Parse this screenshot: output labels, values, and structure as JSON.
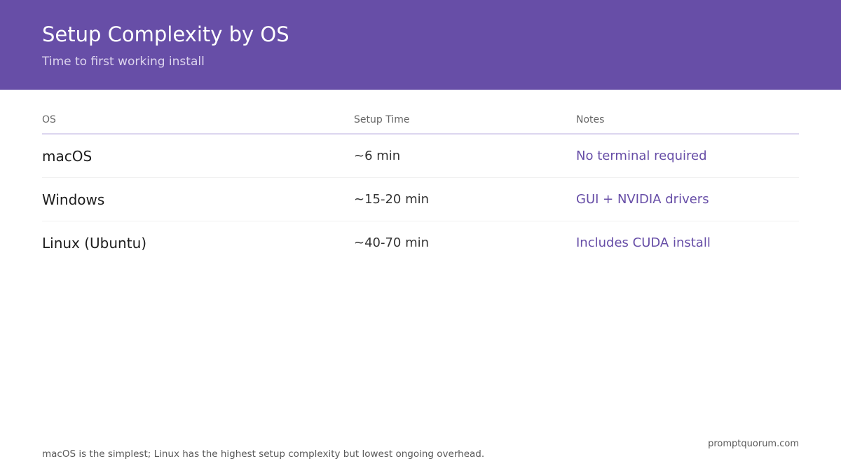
{
  "header": {
    "title": "Setup Complexity by OS",
    "subtitle": "Time to first working install",
    "background_color": "#674ea7"
  },
  "table": {
    "columns": [
      "OS",
      "Setup Time",
      "Notes"
    ],
    "rows": [
      {
        "os": "macOS",
        "setup_time": "~6 min",
        "notes": "No terminal required"
      },
      {
        "os": "Windows",
        "setup_time": "~15-20 min",
        "notes": "GUI + NVIDIA drivers"
      },
      {
        "os": "Linux (Ubuntu)",
        "setup_time": "~40-70 min",
        "notes": "Includes CUDA install"
      }
    ],
    "notes_color": "#674ea7"
  },
  "footer": {
    "note": "macOS is the simplest; Linux has the highest setup complexity but lowest ongoing overhead.",
    "site": "promptquorum.com"
  }
}
